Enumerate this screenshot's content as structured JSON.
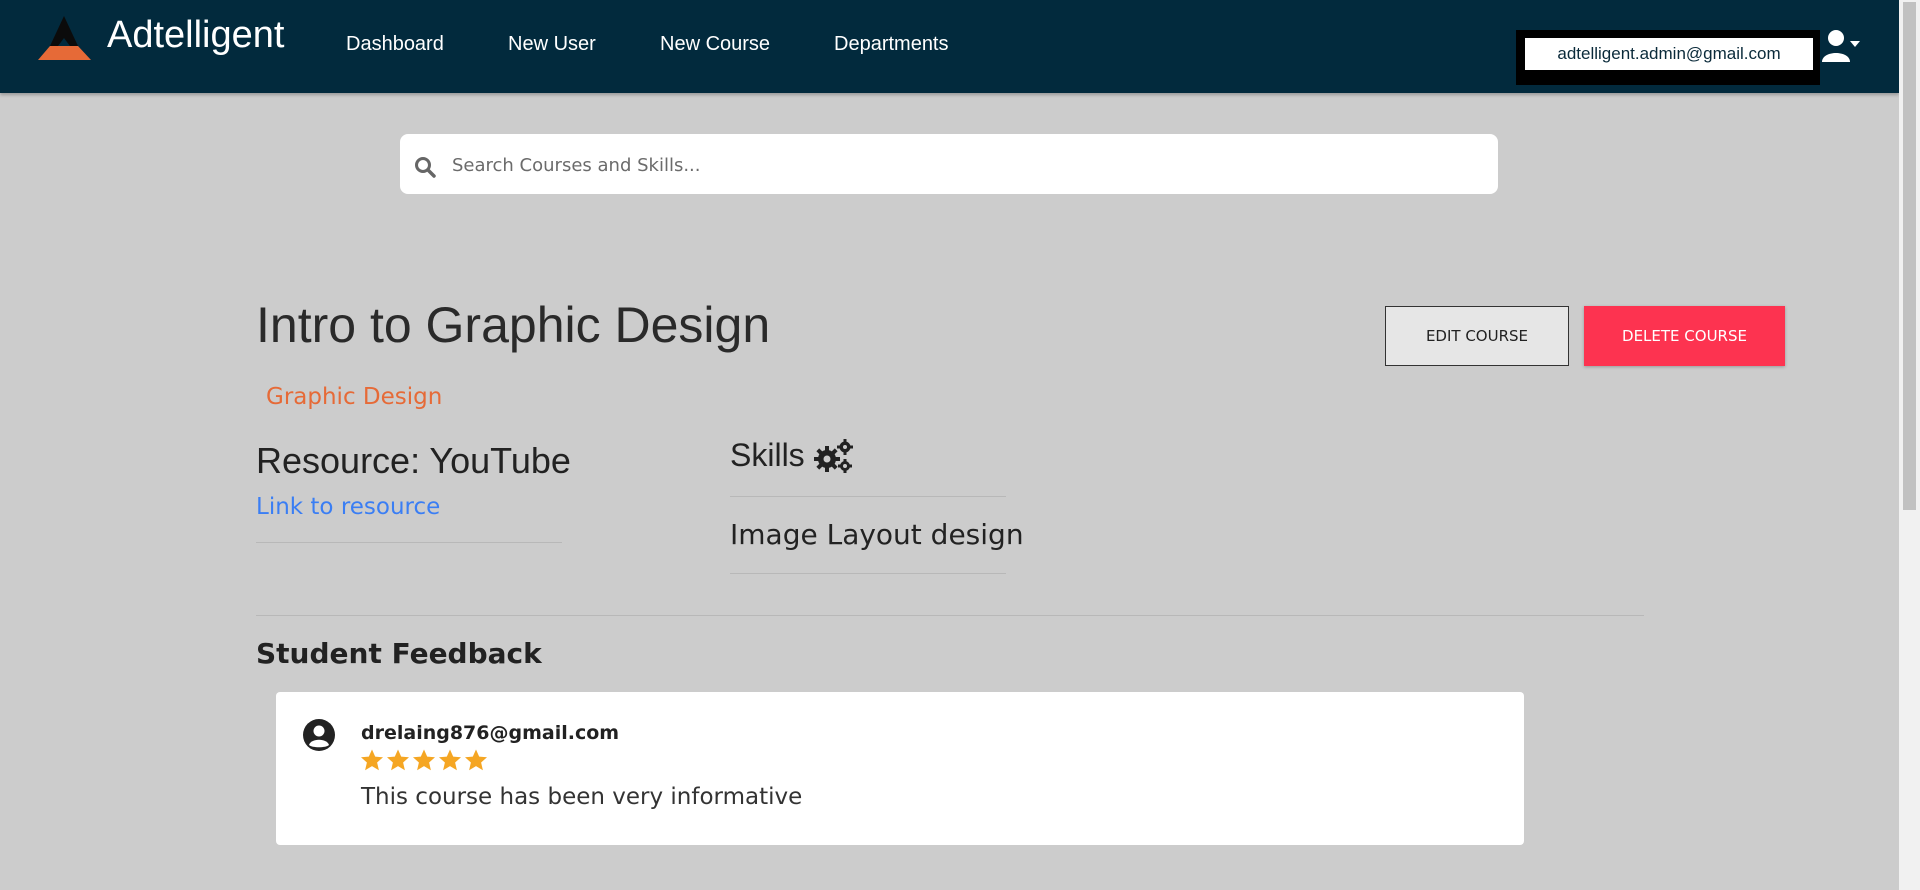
{
  "app": {
    "brand_name": "Adtelligent"
  },
  "nav": {
    "items": [
      {
        "label": "Dashboard"
      },
      {
        "label": "New User"
      },
      {
        "label": "New Course"
      },
      {
        "label": "Departments"
      }
    ],
    "user_email": "adtelligent.admin@gmail.com"
  },
  "search": {
    "placeholder": "Search Courses and Skills..."
  },
  "course": {
    "title": "Intro to Graphic Design",
    "category": "Graphic Design",
    "edit_label": "EDIT COURSE",
    "delete_label": "DELETE COURSE",
    "resource_title": "Resource: YouTube",
    "resource_link_label": "Link to resource",
    "skills_heading": "Skills",
    "skills": [
      "Image Layout design"
    ]
  },
  "feedback": {
    "heading": "Student Feedback",
    "entries": [
      {
        "email": "drelaing876@gmail.com",
        "rating": 5,
        "comment": "This course has been very informative"
      }
    ]
  },
  "colors": {
    "navbar": "#022a3d",
    "brand_accent": "#e66a37",
    "delete_button": "#fd3350",
    "link": "#3a7ef4",
    "star": "#f5a623",
    "background": "#cccccc"
  },
  "icons": [
    "logo-icon",
    "user-menu-icon",
    "search-icon",
    "gears-icon",
    "account-circle-icon",
    "star-icon"
  ]
}
